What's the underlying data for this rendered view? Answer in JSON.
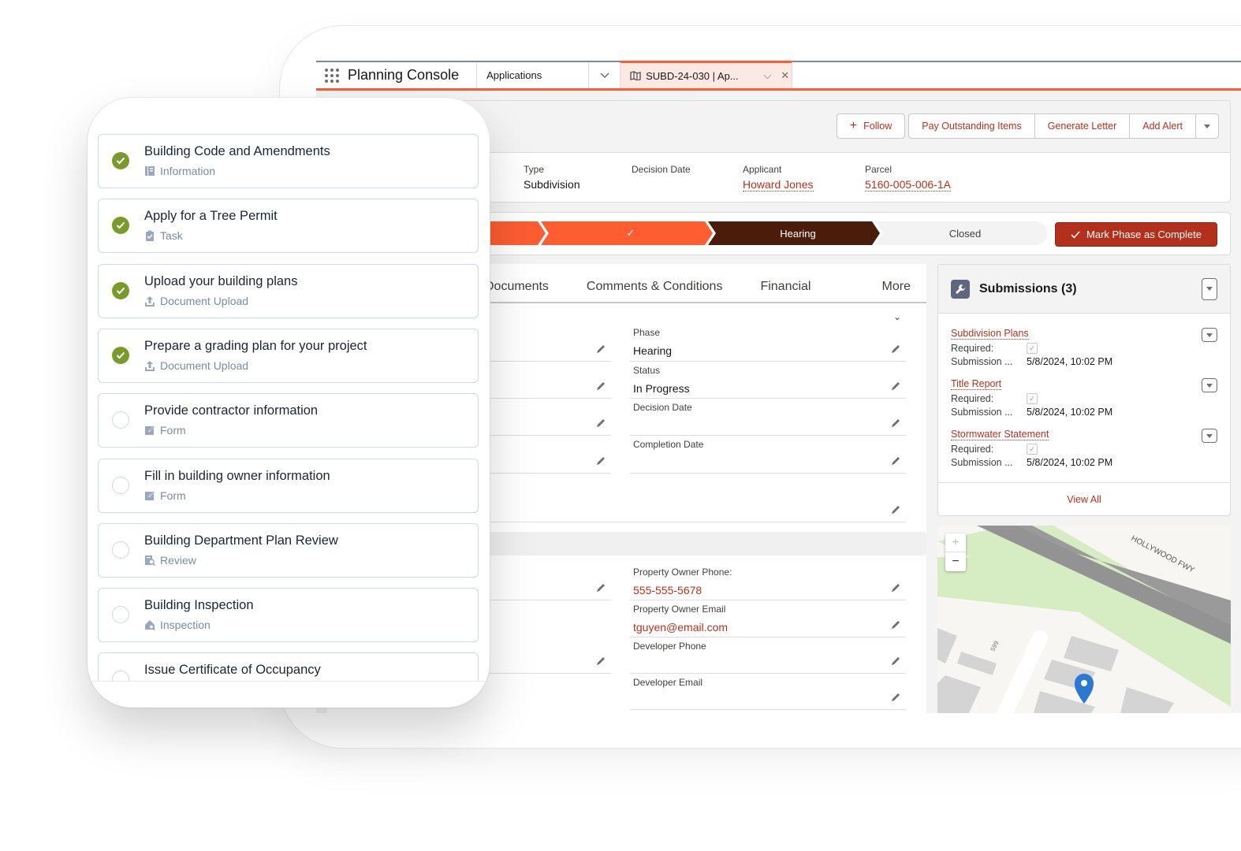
{
  "console": {
    "app_name": "Planning Console",
    "nav_selected": "Applications",
    "record_tab_label": "SUBD-24-030 | Ap...",
    "object_type": "Application",
    "accent_color": "#fe5c31",
    "brand_button_color": "#b2301c"
  },
  "actions": {
    "follow": "Follow",
    "pay": "Pay Outstanding Items",
    "letter": "Generate Letter",
    "alert": "Add Alert"
  },
  "highlights": [
    {
      "label": "Type",
      "value": "Subdivision",
      "link": false
    },
    {
      "label": "Decision Date",
      "value": "",
      "link": false
    },
    {
      "label": "Applicant",
      "value": "Howard Jones",
      "link": true
    },
    {
      "label": "Parcel",
      "value": "5160-005-006-1A",
      "link": true
    }
  ],
  "path": {
    "stages": [
      {
        "label": "",
        "state": "complete"
      },
      {
        "label": "✓",
        "state": "complete"
      },
      {
        "label": "Hearing",
        "state": "current"
      },
      {
        "label": "Closed",
        "state": "incomplete"
      }
    ],
    "complete_button": "Mark Phase as Complete"
  },
  "tabs": [
    "Documents",
    "Comments & Conditions",
    "Financial",
    "More"
  ],
  "detail_fields": {
    "phase": {
      "label": "Phase",
      "value": "Hearing"
    },
    "status": {
      "label": "Status",
      "value": "In Progress"
    },
    "decision_date": {
      "label": "Decision Date",
      "value": ""
    },
    "completion_date": {
      "label": "Completion Date",
      "value": ""
    },
    "owner_phone": {
      "label": "Property Owner Phone:",
      "value": "555-555-5678"
    },
    "owner_email": {
      "label": "Property Owner Email",
      "value": "tguyen@email.com"
    },
    "dev_phone": {
      "label": "Developer Phone",
      "value": ""
    },
    "dev_email": {
      "label": "Developer Email",
      "value": ""
    }
  },
  "submissions": {
    "title": "Submissions (3)",
    "required_label": "Required:",
    "date_label": "Submission ...",
    "items": [
      {
        "name": "Subdivision Plans",
        "required": true,
        "date": "5/8/2024, 10:02 PM"
      },
      {
        "name": "Title Report",
        "required": true,
        "date": "5/8/2024, 10:02 PM"
      },
      {
        "name": "Stormwater Statement",
        "required": true,
        "date": "5/8/2024, 10:02 PM"
      }
    ],
    "view_all": "View All"
  },
  "map": {
    "road_label": "HOLLYWOOD FWY",
    "street_number": "599",
    "zoom_in": "+",
    "zoom_out": "−"
  },
  "mobile_tasks": [
    {
      "title": "Building Code and Amendments",
      "type": "Information",
      "icon": "book-icon",
      "done": true
    },
    {
      "title": "Apply for a Tree Permit",
      "type": "Task",
      "icon": "clipboard-check-icon",
      "done": true
    },
    {
      "title": "Upload your building plans",
      "type": "Document Upload",
      "icon": "upload-icon",
      "done": true
    },
    {
      "title": "Prepare a grading plan for your project",
      "type": "Document Upload",
      "icon": "upload-icon",
      "done": true
    },
    {
      "title": "Provide contractor information",
      "type": "Form",
      "icon": "form-edit-icon",
      "done": false
    },
    {
      "title": "Fill in building owner information",
      "type": "Form",
      "icon": "form-edit-icon",
      "done": false
    },
    {
      "title": "Building Department Plan Review",
      "type": "Review",
      "icon": "document-search-icon",
      "done": false
    },
    {
      "title": "Building Inspection",
      "type": "Inspection",
      "icon": "house-search-icon",
      "done": false
    },
    {
      "title": "Issue Certificate of Occupancy",
      "type": "",
      "icon": "",
      "done": false
    }
  ]
}
